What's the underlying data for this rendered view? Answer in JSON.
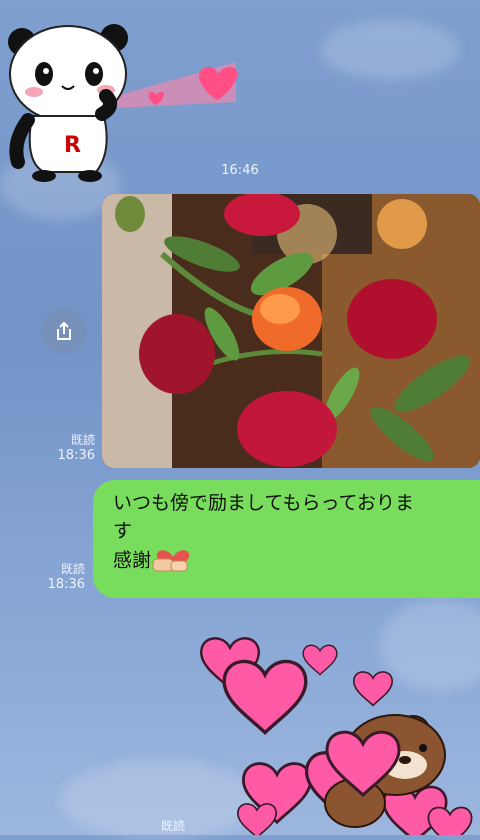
{
  "chat": {
    "time_divider": "16:46",
    "photo_message": {
      "read_label": "既読",
      "time": "18:36"
    },
    "text_message": {
      "line1": "いつも傍で励ましてもらっておりま",
      "line2": "す",
      "line3": "感謝",
      "read_label": "既読",
      "time": "18:36"
    },
    "bottom_message": {
      "read_label": "既読"
    }
  },
  "icons": {
    "share": "share-icon",
    "panda_sticker": "panda-sticker",
    "hug_emoji": "hug-emoji",
    "hearts_sticker": "bear-hearts-sticker"
  },
  "colors": {
    "background": "#7f9fcf",
    "bubble": "#78dc5c",
    "heart": "#ff5aa5"
  }
}
